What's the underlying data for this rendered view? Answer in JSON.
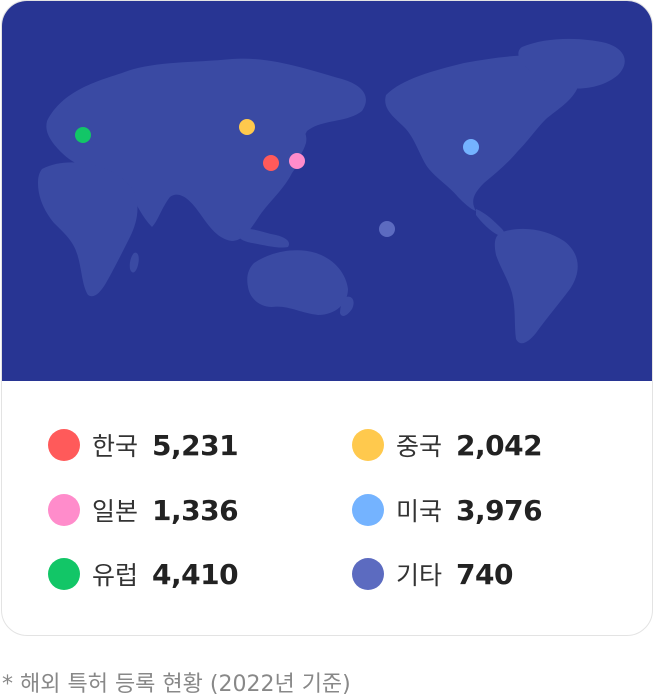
{
  "map": {
    "markers": [
      {
        "name": "korea-marker",
        "color": "#FF5A5A"
      },
      {
        "name": "china-marker",
        "color": "#FFC94D"
      },
      {
        "name": "japan-marker",
        "color": "#FF8CCB"
      },
      {
        "name": "usa-marker",
        "color": "#74B3FF"
      },
      {
        "name": "europe-marker",
        "color": "#12C667"
      },
      {
        "name": "other-marker",
        "color": "#5C6BC0"
      }
    ]
  },
  "stats": [
    {
      "label": "한국",
      "value": "5,231",
      "color": "#FF5A5A"
    },
    {
      "label": "중국",
      "value": "2,042",
      "color": "#FFC94D"
    },
    {
      "label": "일본",
      "value": "1,336",
      "color": "#FF8CCB"
    },
    {
      "label": "미국",
      "value": "3,976",
      "color": "#74B3FF"
    },
    {
      "label": "유럽",
      "value": "4,410",
      "color": "#12C667"
    },
    {
      "label": "기타",
      "value": "740",
      "color": "#5C6BC0"
    }
  ],
  "footnote": "* 해외 특허 등록 현황 (2022년 기준)"
}
